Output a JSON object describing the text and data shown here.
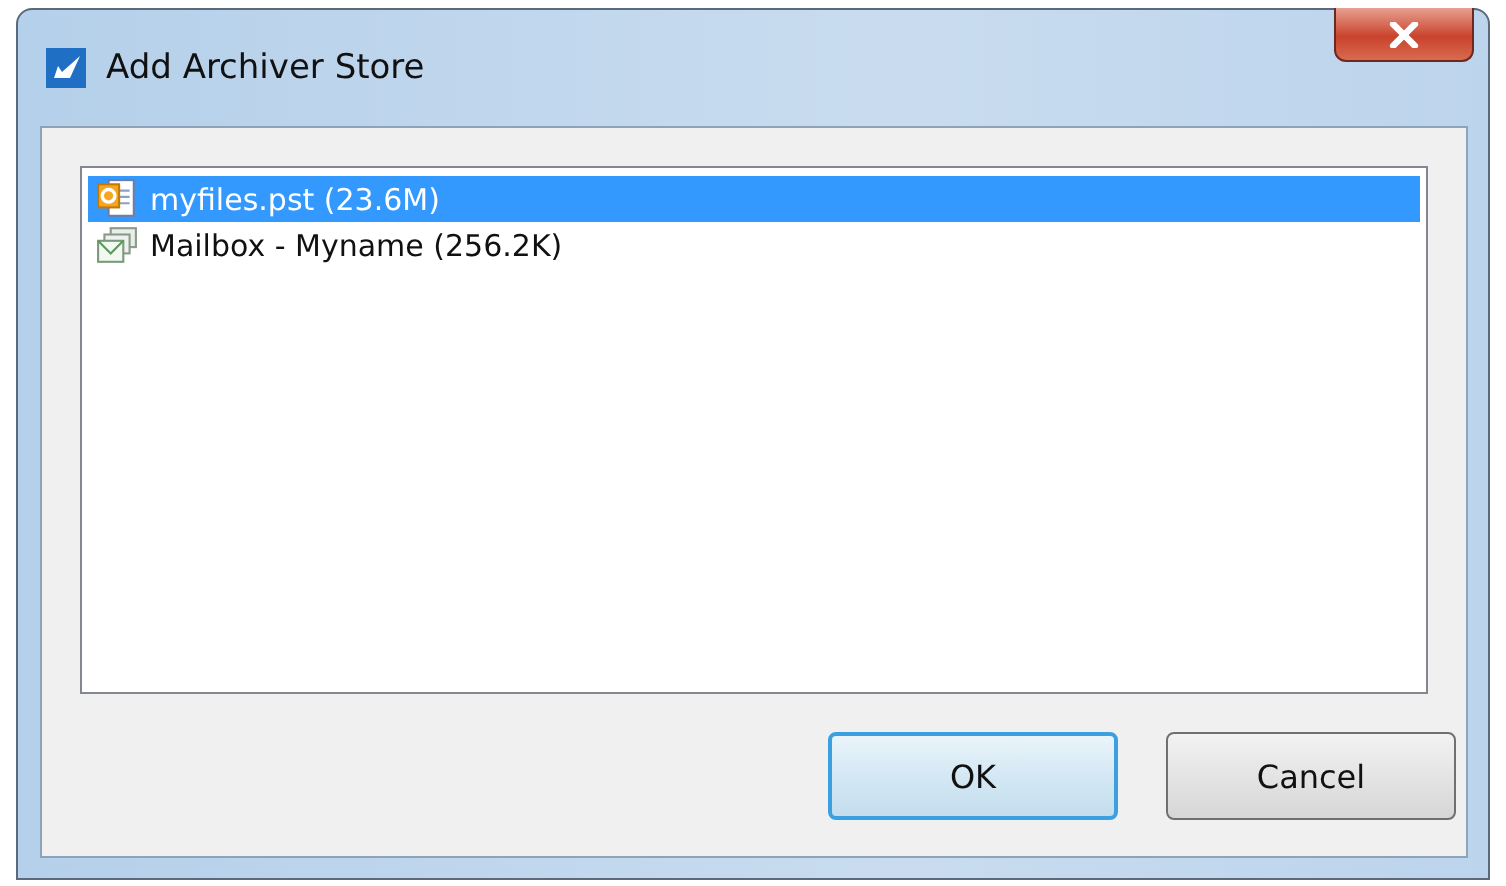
{
  "window": {
    "title": "Add Archiver Store"
  },
  "stores": [
    {
      "label": "myfiles.pst (23.6M)",
      "kind": "pst",
      "selected": true
    },
    {
      "label": "Mailbox - Myname (256.2K)",
      "kind": "mailbox",
      "selected": false
    }
  ],
  "buttons": [
    {
      "label": "OK",
      "default": true
    },
    {
      "label": "Cancel",
      "default": false
    }
  ]
}
